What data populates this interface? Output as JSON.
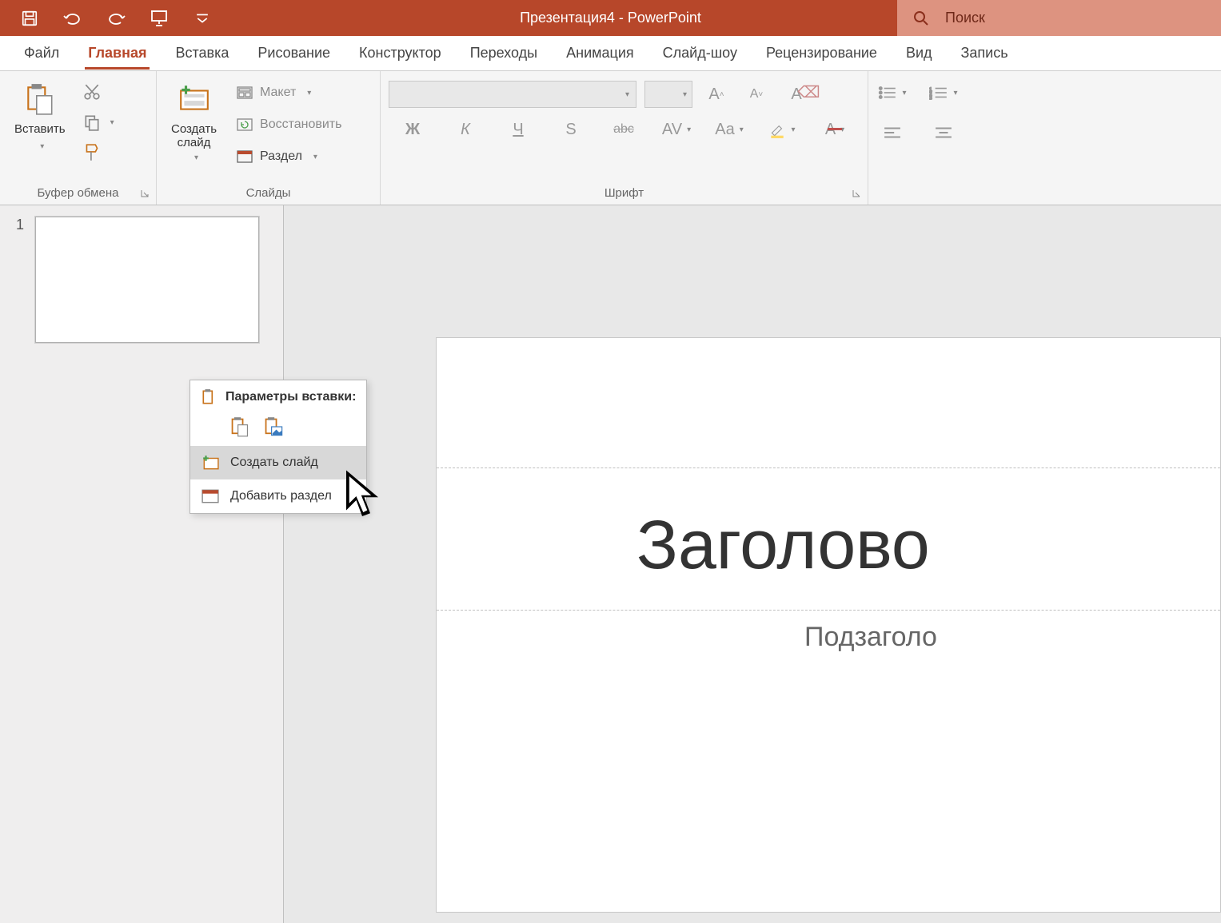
{
  "titlebar": {
    "document_title": "Презентация4  -  PowerPoint",
    "search_placeholder": "Поиск"
  },
  "tabs": {
    "file": "Файл",
    "home": "Главная",
    "insert": "Вставка",
    "draw": "Рисование",
    "design": "Конструктор",
    "transitions": "Переходы",
    "animations": "Анимация",
    "slideshow": "Слайд-шоу",
    "review": "Рецензирование",
    "view": "Вид",
    "record": "Запись"
  },
  "ribbon": {
    "clipboard": {
      "paste": "Вставить",
      "group_label": "Буфер обмена"
    },
    "slides": {
      "new_slide": "Создать\nслайд",
      "layout": "Макет",
      "reset": "Восстановить",
      "section": "Раздел",
      "group_label": "Слайды"
    },
    "font": {
      "bold": "Ж",
      "italic": "К",
      "underline": "Ч",
      "shadow": "S",
      "strike": "abc",
      "spacing": "AV",
      "case": "Aa",
      "group_label": "Шрифт"
    }
  },
  "slide_panel": {
    "slide_number": "1"
  },
  "canvas": {
    "title_placeholder": "Заголово",
    "subtitle_placeholder": "Подзаголо"
  },
  "context_menu": {
    "header": "Параметры вставки:",
    "new_slide": "Создать слайд",
    "add_section": "Добавить раздел"
  }
}
